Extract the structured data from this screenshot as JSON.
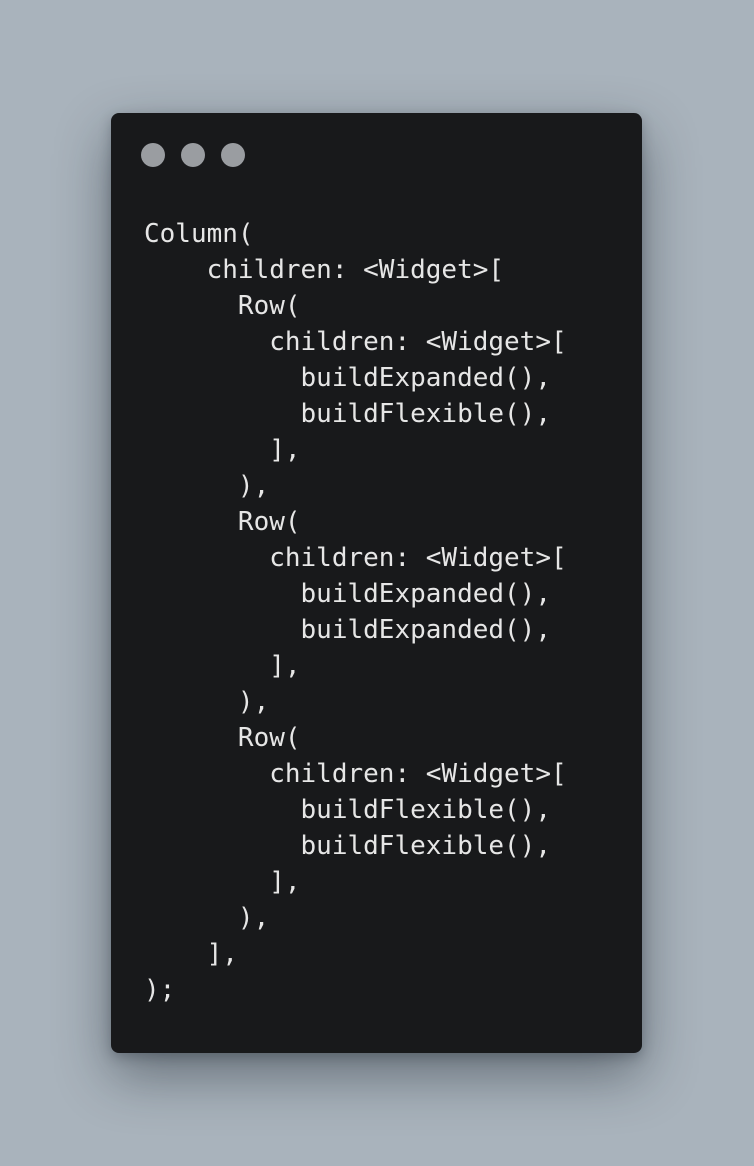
{
  "window": {
    "title": "",
    "colors": {
      "page_background": "#a9b3bc",
      "window_background": "#18191b",
      "traffic_light": "#9a9da1",
      "code_text": "#e6e6e6"
    }
  },
  "code": {
    "language": "dart",
    "lines": [
      "Column(",
      "    children: <Widget>[",
      "      Row(",
      "        children: <Widget>[",
      "          buildExpanded(),",
      "          buildFlexible(),",
      "        ],",
      "      ),",
      "      Row(",
      "        children: <Widget>[",
      "          buildExpanded(),",
      "          buildExpanded(),",
      "        ],",
      "      ),",
      "      Row(",
      "        children: <Widget>[",
      "          buildFlexible(),",
      "          buildFlexible(),",
      "        ],",
      "      ),",
      "    ],",
      ");"
    ]
  }
}
